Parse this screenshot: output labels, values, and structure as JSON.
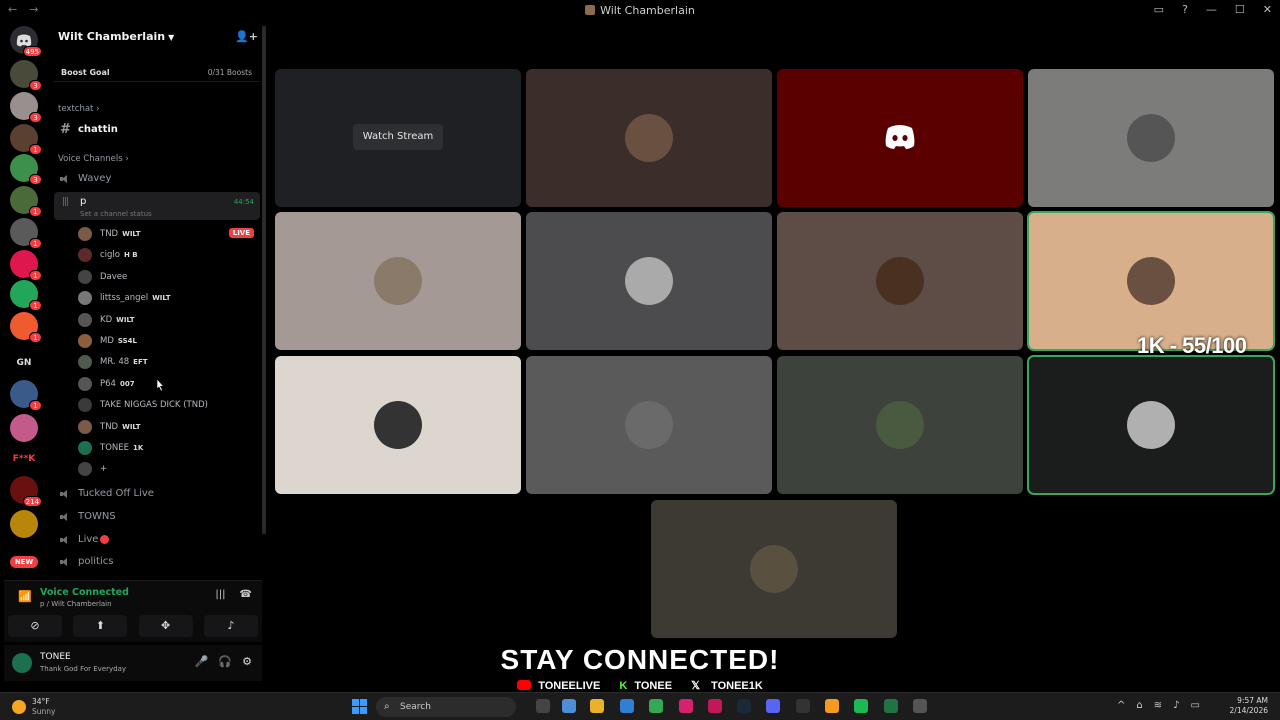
{
  "window": {
    "title": "Wilt Chamberlain"
  },
  "servers": {
    "home_badge": "495",
    "badges": [
      "3",
      "3",
      "1",
      "3",
      "1",
      "1",
      "1",
      "1",
      "1",
      "1",
      "2",
      "214"
    ],
    "text_icons": [
      "GN",
      "F**K"
    ],
    "new_label": "NEW"
  },
  "guild": {
    "name": "Wilt Chamberlain"
  },
  "boost": {
    "label": "Boost Goal",
    "count": "0/31 Boosts"
  },
  "categories": {
    "text": "textchat",
    "voice": "Voice Channels"
  },
  "text_channel": {
    "name": "chattin"
  },
  "voice_channels": {
    "wavey": "Wavey",
    "active": {
      "name": "p",
      "status": "Set a channel status",
      "time": "44:54"
    },
    "others": [
      "Tucked Off Live",
      "TOWNS",
      "Live",
      "politics"
    ]
  },
  "members": [
    {
      "name": "TND",
      "tag": "WILT",
      "live": "LIVE",
      "color": "#7a5a48"
    },
    {
      "name": "ciglo",
      "tag": "H B",
      "color": "#5c2a2a"
    },
    {
      "name": "Davee",
      "tag": "",
      "color": "#444"
    },
    {
      "name": "littss_angel",
      "tag": "WILT",
      "color": "#777"
    },
    {
      "name": "KD",
      "tag": "WILT",
      "color": "#555"
    },
    {
      "name": "MD",
      "tag": "SS4L",
      "color": "#8b5e3c"
    },
    {
      "name": "MR. 48",
      "tag": "EFT",
      "color": "#4e5a4e"
    },
    {
      "name": "P64",
      "tag": "007",
      "color": "#555"
    },
    {
      "name": "TAKE NIGGAS DICK (TND)",
      "tag": "",
      "color": "#3a3a3a"
    },
    {
      "name": "TND",
      "tag": "WILT",
      "color": "#7a5a48"
    },
    {
      "name": "TONEE",
      "tag": "1K",
      "color": "#1c6f4f"
    },
    {
      "name": "+",
      "tag": "",
      "color": "#444"
    }
  ],
  "voice_panel": {
    "title": "Voice Connected",
    "subtitle": "p / Wilt Chamberlain"
  },
  "user": {
    "name": "TONEE",
    "status": "Thank God For Everyday"
  },
  "stage": {
    "watch_label": "Watch Stream",
    "overlay_text": "1K - 55/100",
    "tile_colors": [
      "#1f2023",
      "#3b2d2a",
      "#5a0000",
      "#7c7c7a",
      "#a59995",
      "#4c4c4e",
      "#5e4c47",
      "#d7b08b",
      "#dcd6cf",
      "#5a5a5a",
      "#3d433c",
      "#1b1d1c",
      "#3d3a33"
    ],
    "accent": "#3ba55c"
  },
  "overlay": {
    "headline": "STAY CONNECTED!",
    "youtube": "TONEELIVE",
    "kick": "TONEE",
    "x": "TONEE1K"
  },
  "taskbar": {
    "temp": "34°F",
    "condition": "Sunny",
    "search_placeholder": "Search",
    "time": "9:57 AM",
    "date": "2/14/2026"
  }
}
